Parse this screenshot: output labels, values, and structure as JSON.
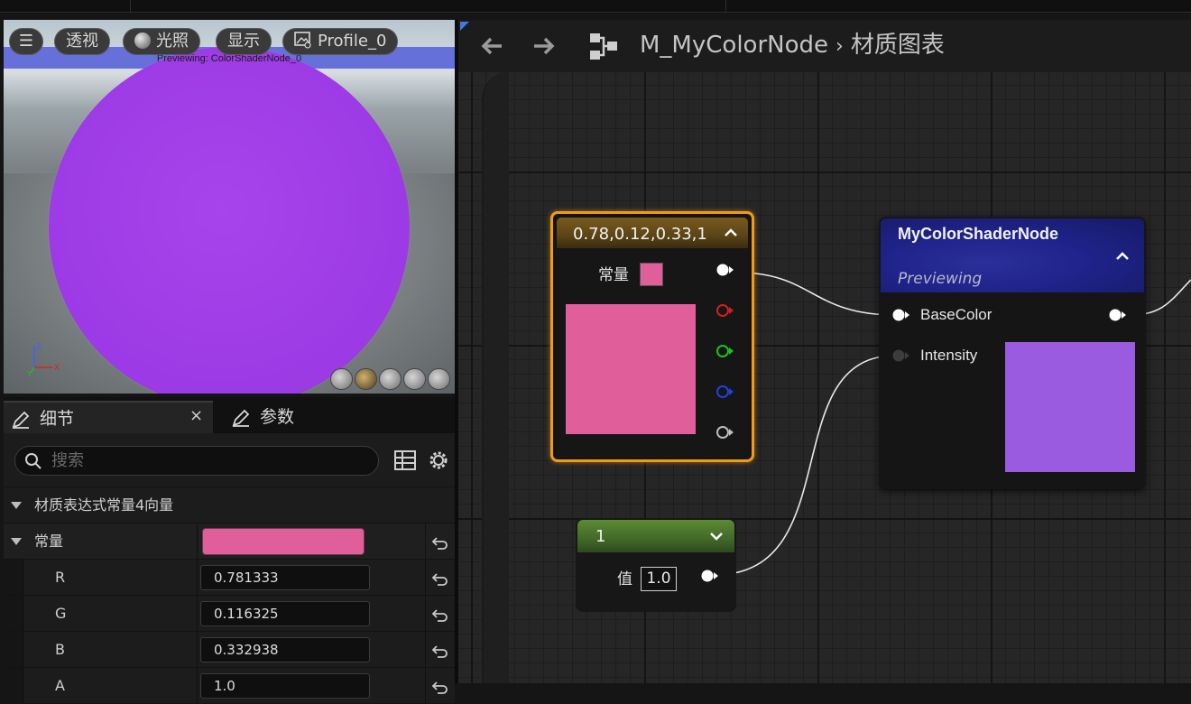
{
  "viewport": {
    "menu_glyph": "☰",
    "buttons": [
      {
        "label": "透视"
      },
      {
        "label": "光照"
      },
      {
        "label": "显示"
      },
      {
        "label": "Profile_0"
      }
    ],
    "previewing_text": "Previewing: ColorShaderNode_0",
    "axis_labels": {
      "z": "Z",
      "x": "X",
      "y": "Y"
    }
  },
  "details": {
    "tabs": [
      {
        "label": "细节",
        "close": "×"
      },
      {
        "label": "参数"
      }
    ],
    "search_placeholder": "搜索",
    "section_title": "材质表达式常量4向量",
    "constant_label": "常量",
    "constant_color": "#e05e9a",
    "fields": [
      {
        "label": "R",
        "value": "0.781333"
      },
      {
        "label": "G",
        "value": "0.116325"
      },
      {
        "label": "B",
        "value": "0.332938"
      },
      {
        "label": "A",
        "value": "1.0"
      }
    ]
  },
  "graph_header": {
    "breadcrumb_asset": "M_MyColorNode",
    "breadcrumb_sep": "›",
    "breadcrumb_graph": "材质图表"
  },
  "nodes": {
    "constant4": {
      "title": "0.78,0.12,0.33,1",
      "row_label": "常量",
      "color": "#e05e9a",
      "pin_colors": [
        "#ffffff",
        "#d02020",
        "#20c020",
        "#2040e0",
        "#bdbdbd"
      ]
    },
    "mycolor": {
      "title": "MyColorShaderNode",
      "subtitle": "Previewing",
      "pins": [
        {
          "label": "BaseColor"
        },
        {
          "label": "Intensity"
        }
      ],
      "preview_color": "#9a5be0"
    },
    "scalar": {
      "title": "1",
      "row_label": "值",
      "value": "1.0"
    }
  }
}
